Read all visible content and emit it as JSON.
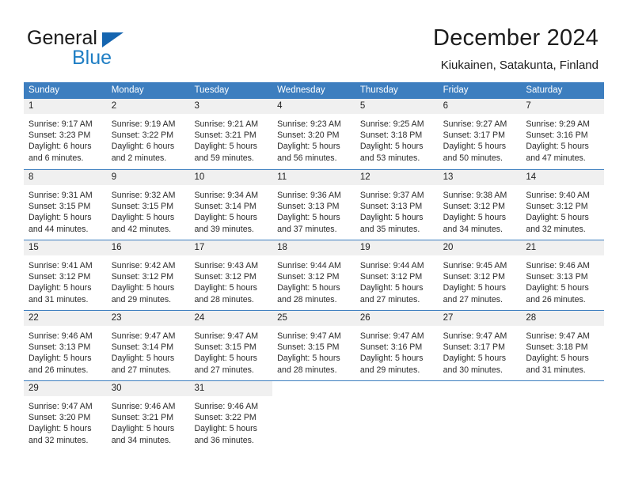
{
  "brand": {
    "name_part1": "General",
    "name_part2": "Blue",
    "accent_color": "#1f7ec4",
    "triangle_color": "#1565b0"
  },
  "header": {
    "title": "December 2024",
    "subtitle": "Kiukainen, Satakunta, Finland"
  },
  "theme": {
    "header_row_bg": "#3d7ebf",
    "header_row_text": "#ffffff",
    "daynum_bg": "#f0f0f0",
    "grid_line": "#3d7ebf"
  },
  "weekdays": [
    "Sunday",
    "Monday",
    "Tuesday",
    "Wednesday",
    "Thursday",
    "Friday",
    "Saturday"
  ],
  "weeks": [
    [
      {
        "day": "1",
        "lines": [
          "Sunrise: 9:17 AM",
          "Sunset: 3:23 PM",
          "Daylight: 6 hours",
          "and 6 minutes."
        ]
      },
      {
        "day": "2",
        "lines": [
          "Sunrise: 9:19 AM",
          "Sunset: 3:22 PM",
          "Daylight: 6 hours",
          "and 2 minutes."
        ]
      },
      {
        "day": "3",
        "lines": [
          "Sunrise: 9:21 AM",
          "Sunset: 3:21 PM",
          "Daylight: 5 hours",
          "and 59 minutes."
        ]
      },
      {
        "day": "4",
        "lines": [
          "Sunrise: 9:23 AM",
          "Sunset: 3:20 PM",
          "Daylight: 5 hours",
          "and 56 minutes."
        ]
      },
      {
        "day": "5",
        "lines": [
          "Sunrise: 9:25 AM",
          "Sunset: 3:18 PM",
          "Daylight: 5 hours",
          "and 53 minutes."
        ]
      },
      {
        "day": "6",
        "lines": [
          "Sunrise: 9:27 AM",
          "Sunset: 3:17 PM",
          "Daylight: 5 hours",
          "and 50 minutes."
        ]
      },
      {
        "day": "7",
        "lines": [
          "Sunrise: 9:29 AM",
          "Sunset: 3:16 PM",
          "Daylight: 5 hours",
          "and 47 minutes."
        ]
      }
    ],
    [
      {
        "day": "8",
        "lines": [
          "Sunrise: 9:31 AM",
          "Sunset: 3:15 PM",
          "Daylight: 5 hours",
          "and 44 minutes."
        ]
      },
      {
        "day": "9",
        "lines": [
          "Sunrise: 9:32 AM",
          "Sunset: 3:15 PM",
          "Daylight: 5 hours",
          "and 42 minutes."
        ]
      },
      {
        "day": "10",
        "lines": [
          "Sunrise: 9:34 AM",
          "Sunset: 3:14 PM",
          "Daylight: 5 hours",
          "and 39 minutes."
        ]
      },
      {
        "day": "11",
        "lines": [
          "Sunrise: 9:36 AM",
          "Sunset: 3:13 PM",
          "Daylight: 5 hours",
          "and 37 minutes."
        ]
      },
      {
        "day": "12",
        "lines": [
          "Sunrise: 9:37 AM",
          "Sunset: 3:13 PM",
          "Daylight: 5 hours",
          "and 35 minutes."
        ]
      },
      {
        "day": "13",
        "lines": [
          "Sunrise: 9:38 AM",
          "Sunset: 3:12 PM",
          "Daylight: 5 hours",
          "and 34 minutes."
        ]
      },
      {
        "day": "14",
        "lines": [
          "Sunrise: 9:40 AM",
          "Sunset: 3:12 PM",
          "Daylight: 5 hours",
          "and 32 minutes."
        ]
      }
    ],
    [
      {
        "day": "15",
        "lines": [
          "Sunrise: 9:41 AM",
          "Sunset: 3:12 PM",
          "Daylight: 5 hours",
          "and 31 minutes."
        ]
      },
      {
        "day": "16",
        "lines": [
          "Sunrise: 9:42 AM",
          "Sunset: 3:12 PM",
          "Daylight: 5 hours",
          "and 29 minutes."
        ]
      },
      {
        "day": "17",
        "lines": [
          "Sunrise: 9:43 AM",
          "Sunset: 3:12 PM",
          "Daylight: 5 hours",
          "and 28 minutes."
        ]
      },
      {
        "day": "18",
        "lines": [
          "Sunrise: 9:44 AM",
          "Sunset: 3:12 PM",
          "Daylight: 5 hours",
          "and 28 minutes."
        ]
      },
      {
        "day": "19",
        "lines": [
          "Sunrise: 9:44 AM",
          "Sunset: 3:12 PM",
          "Daylight: 5 hours",
          "and 27 minutes."
        ]
      },
      {
        "day": "20",
        "lines": [
          "Sunrise: 9:45 AM",
          "Sunset: 3:12 PM",
          "Daylight: 5 hours",
          "and 27 minutes."
        ]
      },
      {
        "day": "21",
        "lines": [
          "Sunrise: 9:46 AM",
          "Sunset: 3:13 PM",
          "Daylight: 5 hours",
          "and 26 minutes."
        ]
      }
    ],
    [
      {
        "day": "22",
        "lines": [
          "Sunrise: 9:46 AM",
          "Sunset: 3:13 PM",
          "Daylight: 5 hours",
          "and 26 minutes."
        ]
      },
      {
        "day": "23",
        "lines": [
          "Sunrise: 9:47 AM",
          "Sunset: 3:14 PM",
          "Daylight: 5 hours",
          "and 27 minutes."
        ]
      },
      {
        "day": "24",
        "lines": [
          "Sunrise: 9:47 AM",
          "Sunset: 3:15 PM",
          "Daylight: 5 hours",
          "and 27 minutes."
        ]
      },
      {
        "day": "25",
        "lines": [
          "Sunrise: 9:47 AM",
          "Sunset: 3:15 PM",
          "Daylight: 5 hours",
          "and 28 minutes."
        ]
      },
      {
        "day": "26",
        "lines": [
          "Sunrise: 9:47 AM",
          "Sunset: 3:16 PM",
          "Daylight: 5 hours",
          "and 29 minutes."
        ]
      },
      {
        "day": "27",
        "lines": [
          "Sunrise: 9:47 AM",
          "Sunset: 3:17 PM",
          "Daylight: 5 hours",
          "and 30 minutes."
        ]
      },
      {
        "day": "28",
        "lines": [
          "Sunrise: 9:47 AM",
          "Sunset: 3:18 PM",
          "Daylight: 5 hours",
          "and 31 minutes."
        ]
      }
    ],
    [
      {
        "day": "29",
        "lines": [
          "Sunrise: 9:47 AM",
          "Sunset: 3:20 PM",
          "Daylight: 5 hours",
          "and 32 minutes."
        ]
      },
      {
        "day": "30",
        "lines": [
          "Sunrise: 9:46 AM",
          "Sunset: 3:21 PM",
          "Daylight: 5 hours",
          "and 34 minutes."
        ]
      },
      {
        "day": "31",
        "lines": [
          "Sunrise: 9:46 AM",
          "Sunset: 3:22 PM",
          "Daylight: 5 hours",
          "and 36 minutes."
        ]
      },
      {
        "day": "",
        "lines": []
      },
      {
        "day": "",
        "lines": []
      },
      {
        "day": "",
        "lines": []
      },
      {
        "day": "",
        "lines": []
      }
    ]
  ]
}
